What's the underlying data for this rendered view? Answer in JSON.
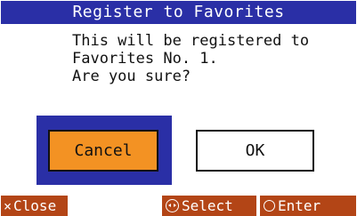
{
  "dialog": {
    "title": "Register to Favorites",
    "message_lines": [
      "This will be registered to",
      "Favorites No. 1.",
      "Are you sure?"
    ],
    "cancel_label": "Cancel",
    "ok_label": "OK",
    "focused_button": "Cancel"
  },
  "footer": {
    "close_label": "Close",
    "close_icon": "cross-icon",
    "select_label": "Select",
    "select_icon": "dial-icon",
    "enter_label": "Enter",
    "enter_icon": "circle-icon"
  },
  "colors": {
    "title_bar": "#2a2fa6",
    "focus_frame": "#2a2fa6",
    "cancel_fill": "#f39223",
    "footer_button": "#b34516"
  }
}
